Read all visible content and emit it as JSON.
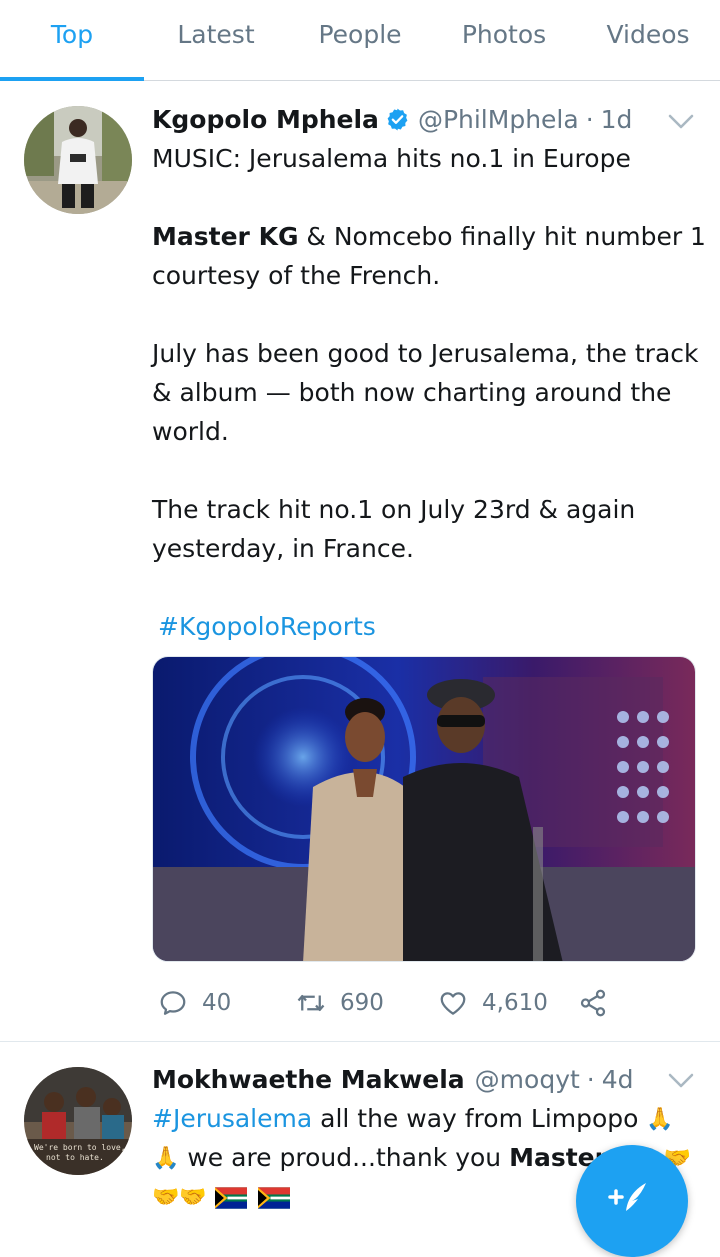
{
  "tabs": [
    {
      "label": "Top",
      "active": true
    },
    {
      "label": "Latest",
      "active": false
    },
    {
      "label": "People",
      "active": false
    },
    {
      "label": "Photos",
      "active": false
    },
    {
      "label": "Videos",
      "active": false
    }
  ],
  "tweet1": {
    "name": "Kgopolo Mphela",
    "verified": true,
    "handle": "@PhilMphela",
    "dot": "·",
    "time": "1d",
    "line1": "MUSIC: Jerusalema hits no.1 in Europe",
    "line2_bold": "Master KG",
    "line2_rest": " & Nomcebo finally hit number 1",
    "line3": "courtesy of the French.",
    "line4": "July has been good to Jerusalema, the track",
    "line5": "& album — both now charting around the",
    "line6": "world.",
    "line7": "The track hit no.1 on July 23rd & again",
    "line8": "yesterday, in France.",
    "hashtag": "#KgopoloReports",
    "replies": "40",
    "retweets": "690",
    "likes": "4,610"
  },
  "tweet2": {
    "name": "Mokhwaethe Makwela",
    "handle": "@moqyt",
    "dot": "·",
    "time": "4d",
    "hashtag": "#Jerusalema",
    "line1_rest": " all the way from Limpopo",
    "emoji_pray": "🙏",
    "line2_rest": " we are proud...thank you ",
    "line2_bold": "Master KG",
    "emoji_handshake": "🤝",
    "avatar_caption": "We're born to love,\nnot to hate."
  },
  "colors": {
    "accent": "#1da1f2",
    "link": "#1b95e0",
    "muted": "#657786",
    "text": "#14171a"
  },
  "icons": [
    "verified-badge-icon",
    "chevron-down-icon",
    "reply-icon",
    "retweet-icon",
    "like-icon",
    "share-icon",
    "compose-icon",
    "south-africa-flag-icon"
  ]
}
